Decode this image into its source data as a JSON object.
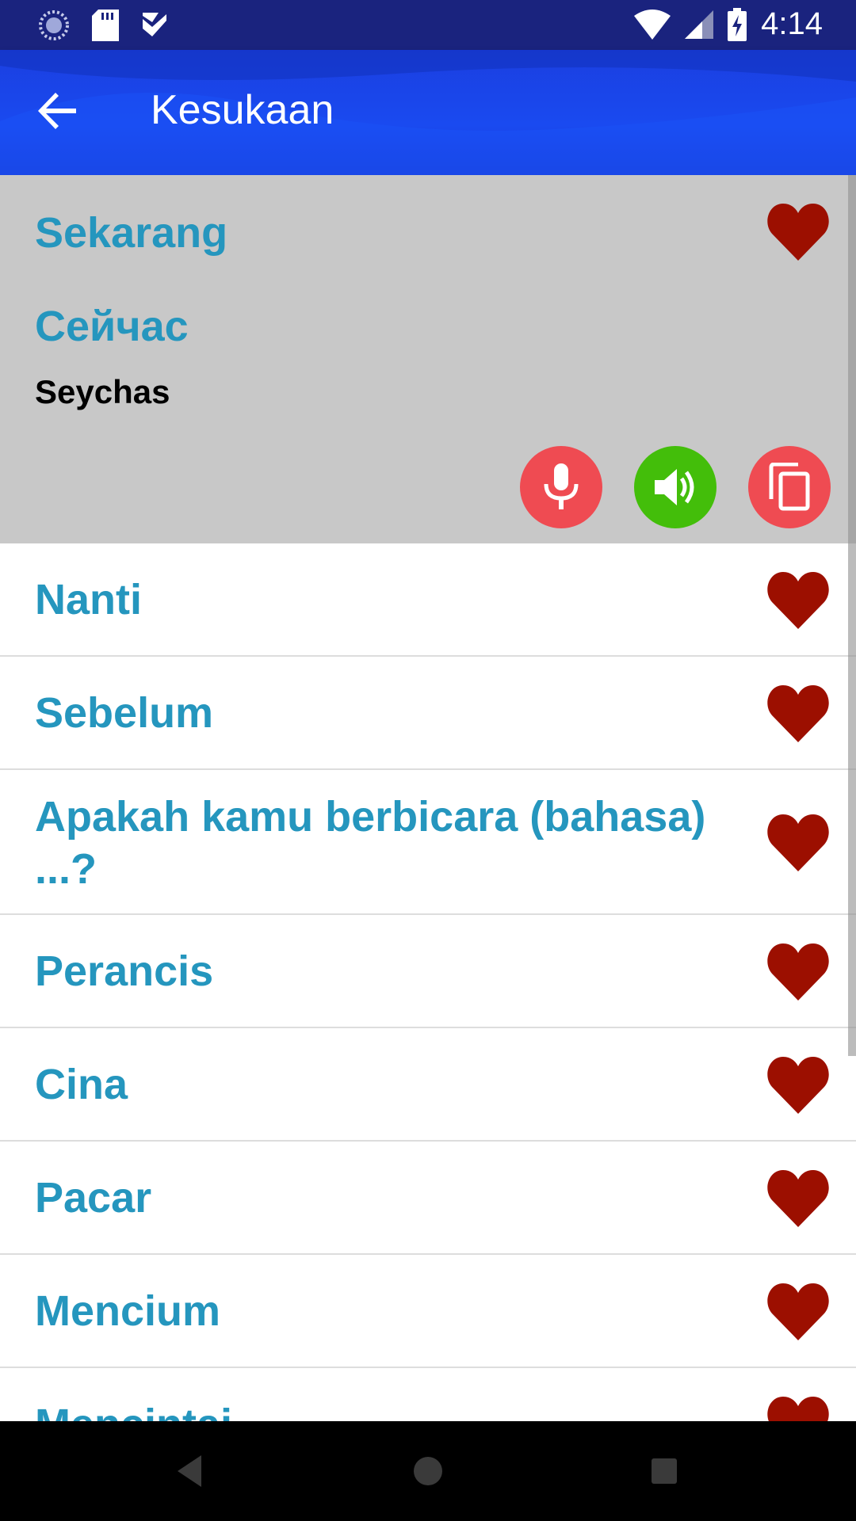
{
  "status_bar": {
    "time": "4:14",
    "left_icons": [
      "spinner-icon",
      "sd-card-icon",
      "check-notification-icon"
    ],
    "right_icons": [
      "wifi-icon",
      "cell-signal-icon",
      "battery-charging-icon"
    ]
  },
  "app_bar": {
    "title": "Kesukaan",
    "back_icon": "arrow-back-icon",
    "color": "#1a4af0"
  },
  "expanded_item": {
    "phrase": "Sekarang",
    "translation": "Сейчас",
    "transliteration": "Seychas",
    "favorite": true,
    "actions": [
      {
        "name": "mic",
        "icon": "microphone-icon",
        "color": "#ef4b52"
      },
      {
        "name": "speak",
        "icon": "speaker-icon",
        "color": "#43be0a"
      },
      {
        "name": "copy",
        "icon": "copy-icon",
        "color": "#ef4b52"
      }
    ]
  },
  "items": [
    {
      "label": "Nanti",
      "favorite": true
    },
    {
      "label": "Sebelum",
      "favorite": true
    },
    {
      "label": "Apakah kamu berbicara (bahasa) ...?",
      "favorite": true
    },
    {
      "label": "Perancis",
      "favorite": true
    },
    {
      "label": "Cina",
      "favorite": true
    },
    {
      "label": "Pacar",
      "favorite": true
    },
    {
      "label": "Mencium",
      "favorite": true
    },
    {
      "label": "Mencintai",
      "favorite": true
    }
  ],
  "colors": {
    "phrase_text": "#2596be",
    "heart": "#9c0f00",
    "expanded_background": "#c8c8c8"
  },
  "nav_bar": {
    "buttons": [
      "back-triangle-icon",
      "home-circle-icon",
      "recents-square-icon"
    ]
  }
}
